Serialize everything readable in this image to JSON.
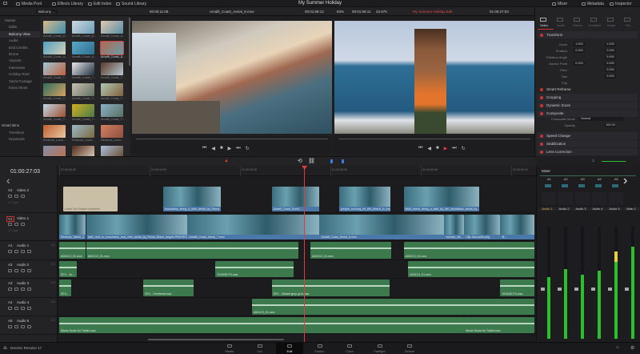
{
  "app": {
    "title": "My Summer Holiday",
    "product": "DaVinci Resolve 17"
  },
  "top_tabs": [
    {
      "label": "Media Pool",
      "icon": "media-pool-icon"
    },
    {
      "label": "Effects Library",
      "icon": "effects-icon"
    },
    {
      "label": "Edit Index",
      "icon": "edit-index-icon"
    },
    {
      "label": "Sound Library",
      "icon": "sound-library-icon"
    }
  ],
  "right_tabs": [
    {
      "label": "Mixer",
      "icon": "mixer-icon"
    },
    {
      "label": "Metadata",
      "icon": "metadata-icon"
    },
    {
      "label": "Inspector",
      "icon": "inspector-icon"
    }
  ],
  "toolbar": {
    "bin_select": "Balcony ...",
    "source_timecode": "00:00:11:09",
    "source_clip": "Amalfi_Coast_Aerial_8.mov",
    "source_tc2": "00:01:58:12",
    "zoom": "83%",
    "program_duration": "00:01:06:11",
    "fps": "23.976",
    "timeline_name": "My Summer Holiday Edit",
    "program_timecode": "01:00:27:03",
    "inspector_title": "Timeline - lake_next_to_mo...lack_Artgrid-PRORES422.mov"
  },
  "bins": {
    "items": [
      "Master",
      "Edits",
      "Balcony View",
      "Audio",
      "End Credits",
      "Drone",
      "Airports",
      "Interviews",
      "Holiday Reel",
      "Yacht Footage",
      "Extra Shots"
    ],
    "selected": "Balcony View",
    "smart_bins_label": "Smart Bins",
    "smart_bins": [
      "Timelines",
      "Keywords"
    ]
  },
  "media": [
    {
      "name": "Amalfi_Coast_A...",
      "c": [
        "#d9b98a",
        "#3f8fb0"
      ]
    },
    {
      "name": "Amalfi_Coast_A...",
      "c": [
        "#cfd8e0",
        "#6d9fb9"
      ]
    },
    {
      "name": "Amalfi_Coast_A...",
      "c": [
        "#e0c8b0",
        "#5a8fa8"
      ]
    },
    {
      "name": "Amalfi_Coast_A...",
      "c": [
        "#4fa0c0",
        "#d8d0b8"
      ]
    },
    {
      "name": "Amalfi_Coast_A...",
      "c": [
        "#5aa8c8",
        "#2f6f8f"
      ]
    },
    {
      "name": "Amalfi_Coast_A...",
      "c": [
        "#b06a50",
        "#6a9aa8"
      ],
      "selected": true
    },
    {
      "name": "Amalfi_Coast_T...",
      "c": [
        "#9fc8d8",
        "#c06040"
      ]
    },
    {
      "name": "Amalfi_Coast_T...",
      "c": [
        "#e8e8e8",
        "#203040"
      ]
    },
    {
      "name": "Amalfi_Coast_T...",
      "c": [
        "#5a3a2a",
        "#b8c8d0"
      ]
    },
    {
      "name": "Amalfi_Coast_T...",
      "c": [
        "#2f6f5f",
        "#d8a060"
      ]
    },
    {
      "name": "Amalfi_Coast_T...",
      "c": [
        "#c8c0b0",
        "#607060"
      ]
    },
    {
      "name": "Amalfi_Coast_T...",
      "c": [
        "#b0c8b0",
        "#806040"
      ]
    },
    {
      "name": "Amalfi_Coast_T...",
      "c": [
        "#c0d8e8",
        "#a05030"
      ]
    },
    {
      "name": "Amalfi_Coast_T...",
      "c": [
        "#d0b020",
        "#4a7a4a"
      ]
    },
    {
      "name": "Amalfi_Coast_T...",
      "c": [
        "#8ab0c8",
        "#5a7060"
      ]
    },
    {
      "name": "Redrock_Land...",
      "c": [
        "#c06030",
        "#e8c8a0"
      ]
    },
    {
      "name": "Redrock_Land...",
      "c": [
        "#9ab8c8",
        "#7a6a40"
      ]
    },
    {
      "name": "Redrock_Land...",
      "c": [
        "#d08060",
        "#905040"
      ]
    },
    {
      "name": "",
      "c": [
        "#8090a8",
        "#c07050"
      ]
    },
    {
      "name": "",
      "c": [
        "#502818",
        "#e0d0c0"
      ]
    },
    {
      "name": "",
      "c": [
        "#a8c0d8",
        "#6a4a30"
      ]
    }
  ],
  "inspector": {
    "tabs": [
      "Video",
      "Audio",
      "Effects",
      "Transition",
      "Image",
      "File"
    ],
    "active_tab": "Video",
    "transform_label": "Transform",
    "params": [
      {
        "label": "Zoom",
        "x": "1.000",
        "y": "1.000"
      },
      {
        "label": "Position",
        "x": "0.000",
        "y": "0.000"
      },
      {
        "label": "Rotation Angle",
        "y": "0.000"
      },
      {
        "label": "Anchor Point",
        "x": "0.000",
        "y": "0.000"
      },
      {
        "label": "Pitch",
        "y": "0.000"
      },
      {
        "label": "Yaw",
        "y": "0.000"
      },
      {
        "label": "Flip"
      }
    ],
    "sections": [
      "Smart Reframe",
      "Cropping",
      "Dynamic Zoom",
      "Composite",
      "Speed Change",
      "Stabilization",
      "Lens Correction"
    ],
    "composite_mode_label": "Composite Mode",
    "composite_mode": "Normal",
    "opacity_label": "Opacity",
    "opacity": "100.00"
  },
  "timeline": {
    "timecode": "01:00:27:03",
    "playhead_sec": 27.1,
    "ruler": [
      "01:00:00:00",
      "01:00:10:00",
      "01:00:20:00",
      "01:00:30:00",
      "01:00:40:00",
      "01:00:50:00"
    ],
    "tracks": [
      {
        "id": "V2",
        "name": "Video 2",
        "kind": "v",
        "clips_label": "11 Clips",
        "clips": [
          {
            "s": 0.4,
            "e": 6.5,
            "name": "Lower 3rd Simple Underline",
            "title": true
          },
          {
            "s": 11.5,
            "e": 17.9,
            "name": "mountains_along_a_lake_aerial_by_Roma..."
          },
          {
            "s": 23.5,
            "e": 28.8,
            "name": "Amalfi_Coast_Sceni..."
          },
          {
            "s": 31,
            "e": 36.7,
            "name": "people_running_on_the_beach_in_brig..."
          },
          {
            "s": 38.1,
            "e": 46.5,
            "name": "thick_forest_along_a_lake_by_the_mountains_aerial_by..."
          }
        ]
      },
      {
        "id": "V1",
        "name": "Video 1",
        "kind": "v",
        "clips_label": "17 Clips",
        "clips": [
          {
            "s": 0,
            "e": 3,
            "name": "Redrock_Talent_3..."
          },
          {
            "s": 3,
            "e": 14.2,
            "name": "lake_next_to_mountains_and_mee_aerial_by_Roma_Black_Artgrid-PRORESA..."
          },
          {
            "s": 14.2,
            "e": 28.8,
            "name": "Amalfi_Coast_Aerial_7.mov"
          },
          {
            "s": 28.8,
            "e": 42.6,
            "name": "Amalfi_Coast_Aerial_8.mov"
          },
          {
            "s": 42.6,
            "e": 44.8,
            "name": "woman_vid..."
          },
          {
            "s": 44.8,
            "e": 48.8,
            "name": "Clip-Sea-turtle.png"
          },
          {
            "s": 48.8,
            "e": 52.6,
            "name": "dl..."
          }
        ]
      },
      {
        "id": "A1",
        "name": "Audio 1",
        "kind": "a",
        "level": "2.0",
        "clips": [
          {
            "s": 0,
            "e": 3,
            "name": "A001C2_01.mov"
          },
          {
            "s": 3,
            "e": 26.5,
            "name": "A001C2_01.mov"
          },
          {
            "s": 27.8,
            "e": 36.8,
            "name": "A001C2_01.mov"
          },
          {
            "s": 38.1,
            "e": 52.6,
            "name": "A001C2_01.mov"
          }
        ]
      },
      {
        "id": "A2",
        "name": "Audio 2",
        "kind": "a",
        "level": "2.0",
        "clips": [
          {
            "s": 0,
            "e": 2,
            "name": "SFX - Je..."
          },
          {
            "s": 17.3,
            "e": 26,
            "name": "SOUND FX.wav"
          },
          {
            "s": 38.6,
            "e": 52.6,
            "name": "A001C3_01.mov"
          }
        ]
      },
      {
        "id": "A3",
        "name": "Audio 3",
        "kind": "a",
        "level": "2.0",
        "clips": [
          {
            "s": 0,
            "e": 1.4,
            "name": "SFX..."
          },
          {
            "s": 9.3,
            "e": 14.9,
            "name": "SFX - Overhead.wav"
          },
          {
            "s": 23.5,
            "e": 36.6,
            "name": "SFX - Vibrant grup gl.er.wav"
          },
          {
            "s": 48.8,
            "e": 52.6,
            "name": "SOUND FX.wav"
          }
        ]
      },
      {
        "id": "A4",
        "name": "Audio 4",
        "kind": "a",
        "level": "2.0",
        "clips": [
          {
            "s": 21.3,
            "e": 52.6,
            "name": "A001C3_01.mov"
          }
        ]
      },
      {
        "id": "A5",
        "name": "Audio 5",
        "kind": "a",
        "level": "2.0",
        "clips": [
          {
            "s": 0,
            "e": 44.8,
            "name": "Music Score for Trailer.mov"
          },
          {
            "s": 44.8,
            "e": 52.6,
            "name": "Music Score for Trailer.mov"
          }
        ]
      }
    ]
  },
  "mixer": {
    "title": "Mixer",
    "inputs": [
      "A1",
      "A2",
      "A3",
      "A4",
      "A5"
    ],
    "channels": [
      {
        "name": "Audio 1",
        "level": 0.55
      },
      {
        "name": "Audio 2",
        "level": 0.62
      },
      {
        "name": "Audio 3",
        "level": 0.57
      },
      {
        "name": "Audio 4",
        "level": 0.61
      },
      {
        "name": "Audio 5",
        "level": 0.78,
        "peak": true
      },
      {
        "name": "Main 1",
        "level": 0.82
      }
    ]
  },
  "pages": [
    {
      "label": "Media"
    },
    {
      "label": "Cut"
    },
    {
      "label": "Edit",
      "active": true
    },
    {
      "label": "Fusion"
    },
    {
      "label": "Color"
    },
    {
      "label": "Fairlight"
    },
    {
      "label": "Deliver"
    }
  ],
  "colors": {
    "accent": "#e23b3b",
    "audio_clip": "#3c7a4e",
    "video_clip": "#4a78a8",
    "meter": "#2bbf2b"
  }
}
